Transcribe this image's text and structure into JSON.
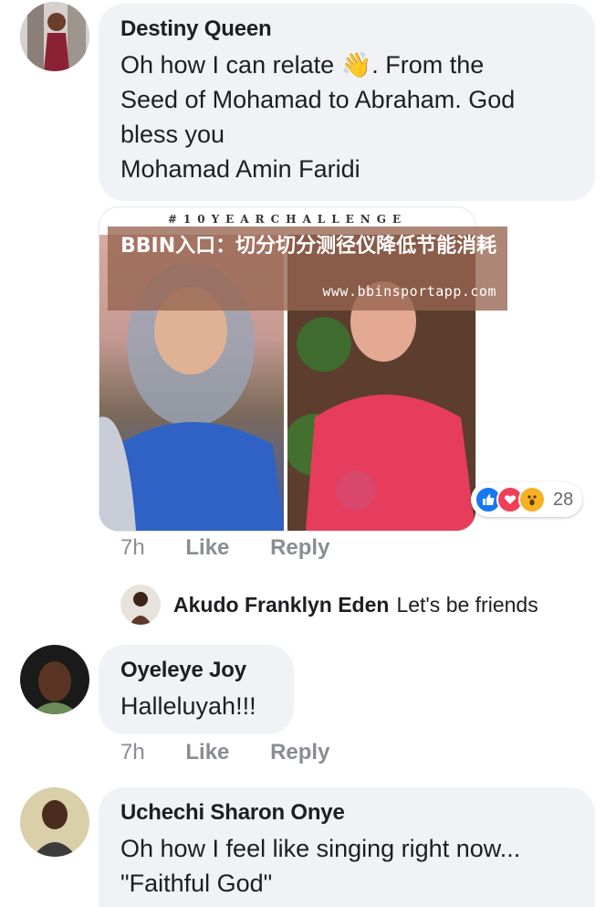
{
  "comments": [
    {
      "author": "Destiny Queen",
      "lines": [
        "Oh how I can relate 👋. From the",
        "Seed of Mohamad to Abraham. God",
        "bless you",
        "Mohamad Amin Faridi"
      ],
      "time": "7h",
      "like_label": "Like",
      "reply_label": "Reply"
    },
    {
      "author": "Oyeleye Joy",
      "lines": [
        "Halleluyah!!!"
      ],
      "time": "7h",
      "like_label": "Like",
      "reply_label": "Reply"
    },
    {
      "author": "Uchechi Sharon Onye",
      "lines": [
        "Oh how I feel like singing right now...",
        "\"Faithful God\""
      ]
    }
  ],
  "photo": {
    "hashtag": "#10YEARCHALLENGE"
  },
  "overlay": {
    "title": "BBIN入口：切分切分测径仪降低节能消耗",
    "url": "www.bbinsportapp.com"
  },
  "reactions": {
    "count": "28",
    "icons": [
      "like-icon",
      "love-icon",
      "wow-icon"
    ],
    "colors": {
      "like": "#1877f2",
      "love": "#f33e58",
      "wow": "#f7b125"
    }
  },
  "reply": {
    "author": "Akudo Franklyn Eden",
    "text": "Let's be friends"
  }
}
